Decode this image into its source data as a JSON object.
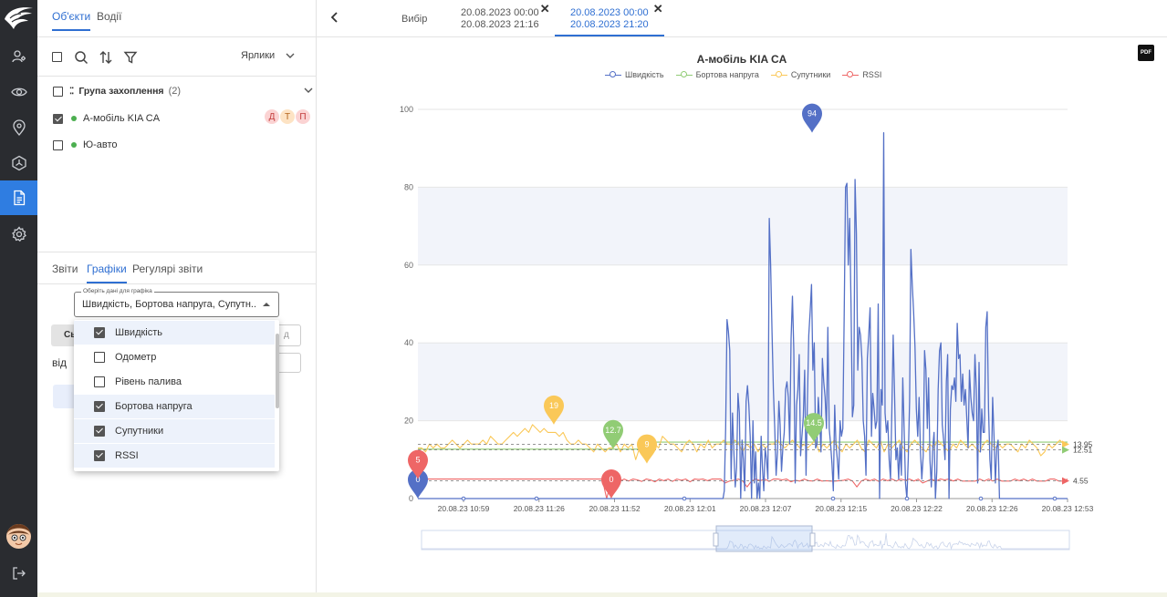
{
  "side": {
    "tabs": [
      "Об'єкти",
      "Водії"
    ],
    "labels_dropdown": "Ярлики",
    "group": {
      "name": "Група захоплення",
      "count": "(2)"
    },
    "objects": [
      {
        "name": "А-мобіль KIA CA",
        "checked": true,
        "badges": [
          "Д",
          "Т",
          "П"
        ]
      },
      {
        "name": "Ю-авто",
        "checked": false
      }
    ],
    "bottom_tabs": [
      "Звіти",
      "Графіки",
      "Регулярі звіти"
    ],
    "select": {
      "legend": "Оберіть дані для графіка",
      "value": "Швидкість, Бортова напруга, Супутн..."
    },
    "under": {
      "button_fragment": "Сь",
      "label_from": "від",
      "field_fragment": "д"
    },
    "dropdown": [
      {
        "label": "Швидкість",
        "checked": true
      },
      {
        "label": "Одометр",
        "checked": false
      },
      {
        "label": "Рівень палива",
        "checked": false
      },
      {
        "label": "Бортова напруга",
        "checked": true
      },
      {
        "label": "Супутники",
        "checked": true
      },
      {
        "label": "RSSI",
        "checked": true
      }
    ]
  },
  "main": {
    "selection_label": "Вибір",
    "periods": [
      {
        "from": "20.08.2023 00:00",
        "to": "20.08.2023 21:16",
        "active": false
      },
      {
        "from": "20.08.2023 00:00",
        "to": "20.08.2023 21:20",
        "active": true
      }
    ],
    "pdf_label": "PDF"
  },
  "chart_data": {
    "type": "line",
    "title": "А-мобіль KIA CA",
    "legend_position": "top",
    "ylim": [
      0,
      100
    ],
    "y_ticks": [
      "0",
      "20",
      "40",
      "60",
      "80",
      "100"
    ],
    "x_ticks": [
      "20.08.23 10:59",
      "20.08.23 11:26",
      "20.08.23 11:52",
      "20.08.23 12:01",
      "20.08.23 12:07",
      "20.08.23 12:15",
      "20.08.23 12:22",
      "20.08.23 12:26",
      "20.08.23 12:53"
    ],
    "series": [
      {
        "name": "Швидкість",
        "color": "#5470c6",
        "values": [
          0,
          0,
          0,
          0,
          0,
          0,
          0,
          0,
          0,
          0,
          0,
          0,
          0,
          0,
          0,
          0,
          0,
          0,
          0,
          0,
          0,
          0,
          0,
          0,
          0,
          0,
          0,
          0,
          0,
          0,
          0,
          0,
          0,
          0,
          0,
          0,
          0,
          0,
          0,
          0,
          0,
          0,
          0,
          0,
          0,
          0,
          0,
          0,
          0,
          0,
          0,
          0,
          0,
          0,
          0,
          0,
          0,
          0,
          0,
          0,
          0,
          0,
          0,
          0,
          0,
          0,
          0,
          0,
          0,
          0,
          0,
          0,
          0,
          0,
          0,
          0,
          0,
          0,
          0,
          0,
          0,
          0,
          0,
          0,
          0,
          0,
          0,
          0,
          0,
          0,
          0,
          0,
          0,
          0,
          0,
          0,
          0,
          0,
          0,
          0,
          0,
          0,
          0,
          0,
          0,
          0,
          0,
          0,
          0,
          0,
          0,
          0,
          0,
          0,
          0,
          0,
          0,
          0,
          0,
          0,
          0,
          0,
          0,
          0,
          0,
          0,
          0,
          0,
          0,
          0,
          0,
          0,
          0,
          0,
          0,
          0,
          0,
          0,
          0,
          0,
          0,
          0,
          0,
          0,
          0,
          0,
          0,
          0,
          0,
          0,
          0,
          0,
          0,
          0,
          0,
          0,
          0,
          0,
          0,
          0,
          0,
          0,
          0,
          0,
          0,
          0,
          0,
          0,
          0,
          0,
          0,
          0,
          0,
          0,
          0,
          0,
          0,
          0,
          0,
          0,
          0,
          0,
          0,
          0,
          0,
          0,
          0,
          0,
          0,
          0,
          0,
          0,
          0,
          0,
          0,
          0,
          0,
          0,
          0,
          0,
          0,
          0,
          0,
          0,
          0,
          0,
          0,
          0,
          0,
          0,
          0,
          0,
          0,
          0,
          0,
          0,
          0,
          0,
          0,
          0,
          0,
          0,
          0,
          0,
          0,
          2,
          18,
          46,
          43,
          38,
          5,
          22,
          12,
          3,
          8,
          27,
          22,
          0,
          15,
          10,
          2,
          25,
          29,
          24,
          16,
          0,
          20,
          4,
          12,
          0,
          4,
          0,
          16,
          8,
          2,
          13,
          10,
          5,
          72,
          60,
          43,
          28,
          18,
          6,
          12,
          25,
          19,
          7,
          13,
          17,
          28,
          30,
          26,
          14,
          41,
          52,
          38,
          4,
          24,
          28,
          37,
          11,
          16,
          21,
          33,
          6,
          25,
          42,
          48,
          55,
          33,
          40,
          13,
          14,
          26,
          20,
          12,
          36,
          30,
          26,
          18,
          44,
          18,
          14,
          9,
          2,
          24,
          14,
          10,
          5,
          20,
          16,
          18,
          47,
          80,
          81,
          60,
          72,
          50,
          21,
          24,
          82,
          68,
          33,
          44,
          42,
          36,
          20,
          16,
          6,
          36,
          42,
          49,
          16,
          27,
          23,
          18,
          20,
          50,
          0,
          28,
          24,
          94,
          22,
          17,
          20,
          10,
          5,
          22,
          42,
          27,
          10,
          13,
          5,
          14,
          6,
          31,
          18,
          4,
          0,
          10,
          25,
          64,
          55,
          48,
          39,
          23,
          16,
          26,
          12,
          5,
          11,
          38,
          33,
          18,
          31,
          10,
          3,
          13,
          17,
          0,
          7,
          28,
          38,
          40,
          19,
          15,
          10,
          30,
          37,
          0,
          23,
          29,
          28,
          31,
          25,
          45,
          36,
          37,
          25,
          32,
          24,
          28,
          21,
          13,
          33,
          26,
          22,
          20,
          37,
          28,
          4,
          35,
          12,
          23,
          17,
          17,
          44,
          48,
          23,
          10,
          5,
          26,
          16,
          4,
          13,
          15,
          0,
          0,
          0,
          0,
          0,
          0,
          0,
          0,
          0,
          0,
          0,
          0,
          0,
          0,
          0,
          0,
          0,
          0,
          0,
          0,
          0,
          0,
          0,
          0,
          0,
          0,
          0,
          0,
          0,
          0,
          0,
          0,
          0,
          0,
          0,
          0,
          0,
          0,
          0,
          0,
          0,
          0,
          0,
          0,
          0,
          0,
          0,
          0,
          0,
          0,
          0
        ]
      },
      {
        "name": "Бортова напруга",
        "color": "#91cc75",
        "values": [
          12.7,
          12.7,
          12.7,
          12.7,
          12.7,
          12.7,
          12.7,
          12.7,
          12.7,
          12.7,
          12.7,
          12.7,
          12.7,
          12.7,
          12.7,
          12.7,
          12.7,
          12.7,
          12.7,
          12.7,
          14.5,
          14.5,
          14.5,
          14.5,
          14.5,
          14.5,
          14.5,
          14.5,
          14.5,
          14.5,
          14.5,
          14.5,
          14.5,
          14.5,
          14.5,
          14.5,
          14.5,
          14.5,
          14.5,
          14.5,
          14.5,
          14.5,
          14.5,
          14.5,
          14.5,
          14.5,
          14.5,
          14.5,
          14.5,
          14.5,
          14.5,
          14.5,
          14.5,
          14.5,
          14.5,
          14.5
        ]
      },
      {
        "name": "Супутники",
        "color": "#fac858",
        "values": [
          13,
          13,
          12,
          14,
          13,
          14,
          13,
          13,
          14,
          15,
          14,
          13,
          14,
          15,
          14,
          14,
          14,
          15,
          14,
          16,
          15,
          14,
          14,
          15,
          16,
          17,
          16,
          17,
          18,
          17,
          19,
          18,
          17,
          18,
          17,
          17,
          17,
          16,
          17,
          15,
          14,
          14,
          15,
          14,
          14,
          13,
          12,
          14,
          13,
          12,
          13,
          13,
          14,
          12,
          14,
          13,
          14,
          10,
          13,
          14,
          12,
          15,
          14,
          13,
          16,
          15,
          14,
          14,
          13,
          12,
          14,
          15,
          14,
          12,
          14,
          13,
          15,
          13,
          14,
          14,
          15,
          14,
          14,
          15,
          14,
          12,
          14,
          13,
          14,
          12,
          14,
          13,
          14,
          14,
          15,
          14,
          13,
          14,
          15,
          14,
          13,
          14,
          13,
          14,
          15,
          12,
          14,
          13,
          14,
          15,
          13,
          12,
          14,
          13,
          14,
          15,
          13,
          12,
          15,
          14,
          13,
          15,
          12,
          14,
          13,
          14,
          15,
          13,
          12,
          14,
          15,
          14,
          13,
          12,
          14,
          13,
          15,
          14,
          13,
          12,
          14,
          13,
          15,
          14,
          13,
          14,
          13,
          12,
          14,
          15,
          14,
          13,
          14,
          13,
          14,
          14,
          13,
          12,
          14,
          13,
          15,
          14,
          13,
          11,
          12,
          14,
          13,
          14,
          15,
          14,
          14
        ]
      },
      {
        "name": "RSSI",
        "color": "#ee6666",
        "values": [
          5,
          5,
          5,
          5,
          5,
          5,
          5,
          5,
          5,
          5,
          5,
          5,
          5,
          5,
          5,
          5,
          5,
          5,
          5,
          5,
          5,
          5,
          5,
          5,
          5,
          5,
          5,
          5,
          5,
          5,
          5,
          5,
          5,
          5,
          5,
          5,
          5,
          5,
          5,
          5,
          5,
          5,
          5,
          0,
          4.5,
          5,
          4.5,
          5,
          4.5,
          5,
          4.8,
          4.4,
          5,
          4.8,
          4.3,
          5,
          4.6,
          5,
          4.4,
          5,
          4.7,
          5,
          4.3,
          5,
          4.9,
          5,
          4.6,
          5,
          5,
          5,
          4,
          4.5,
          4.7,
          5,
          4.5,
          3,
          4.5,
          5,
          4.6,
          5,
          4.4,
          5,
          5,
          4.8,
          5,
          4.3,
          4.7,
          4.5,
          5,
          4.6,
          4.5,
          5,
          4.5,
          4.6,
          4.5,
          4.5,
          4.6,
          4.7,
          5,
          4.5,
          3,
          4.5,
          5,
          4.6,
          5,
          4.4,
          5,
          4.6,
          5,
          4.5,
          5,
          4.7,
          5,
          4.5,
          5,
          4,
          4.5,
          5,
          4.5,
          5,
          4.8,
          5,
          4.5,
          5,
          4.5,
          4.5,
          4.5,
          4.5,
          5,
          4.5,
          5,
          4.5,
          5,
          4.5,
          4.5,
          4.5,
          5,
          4.6,
          5,
          4.5,
          5,
          4.5,
          4.5,
          4.5,
          5,
          5,
          4.5,
          4.5,
          5
        ]
      }
    ],
    "markers": [
      {
        "series": "Швидкість",
        "value": "0"
      },
      {
        "series": "Швидкість",
        "value": "94"
      },
      {
        "series": "Бортова напруга",
        "value": "12.7"
      },
      {
        "series": "Бортова напруга",
        "value": "14.5"
      },
      {
        "series": "Супутники",
        "value": "19"
      },
      {
        "series": "Супутники",
        "value": "9"
      },
      {
        "series": "RSSI",
        "value": "5"
      },
      {
        "series": "RSSI",
        "value": "0"
      }
    ],
    "averages": [
      {
        "series": "Супутники",
        "value": "13.95"
      },
      {
        "series": "Бортова напруга",
        "value": "12.51"
      },
      {
        "series": "RSSI",
        "value": "4.55"
      }
    ]
  }
}
